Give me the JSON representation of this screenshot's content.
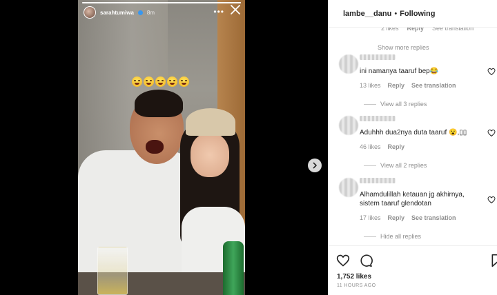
{
  "story": {
    "username": "sarahtumiwa",
    "time": "8m",
    "progress": 1.0,
    "more_label": "•••",
    "emoji_count": 5
  },
  "panel": {
    "header": {
      "username": "lambe__danu",
      "separator": "•",
      "follow_label": "Following"
    },
    "clipped": {
      "likes": "2 likes",
      "reply": "Reply",
      "translate": "See translation"
    },
    "show_more": "Show more replies",
    "comments": [
      {
        "text": "ini namanya taaruf bep😂",
        "likes": "13 likes",
        "reply": "Reply",
        "translate": "See translation",
        "replies": "View all 3 replies"
      },
      {
        "text": "Aduhhh dua2nya duta taaruf 😮,▯▯",
        "likes": "46 likes",
        "reply": "Reply",
        "translate": "",
        "replies": "View all 2 replies"
      },
      {
        "text": "Alhamdulillah ketauan jg akhirnya, sistem taaruf glendotan",
        "likes": "17 likes",
        "reply": "Reply",
        "translate": "See translation",
        "replies": "Hide all replies"
      }
    ],
    "likes_total": "1,752 likes",
    "posted": "11 HOURS AGO"
  },
  "icons": {
    "heart": "heart-icon",
    "comment": "comment-icon",
    "bookmark": "bookmark-icon",
    "close": "close-icon",
    "next": "chevron-right-icon"
  }
}
